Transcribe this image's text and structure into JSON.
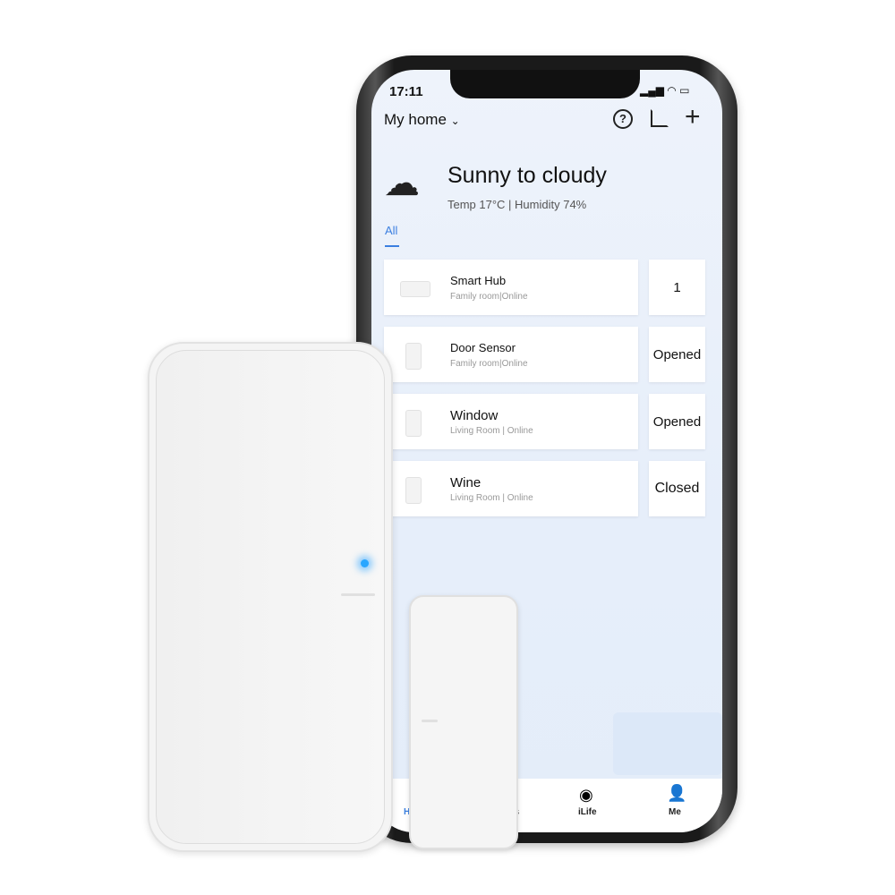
{
  "status_bar": {
    "time": "17:11"
  },
  "header": {
    "home_label": "My home",
    "help_icon": "help-circle-icon",
    "edit_icon": "edit-icon",
    "add_icon": "plus-icon"
  },
  "weather": {
    "icon": "partly-cloudy-icon",
    "title": "Sunny to cloudy",
    "details": "Temp 17°C | Humidity 74%"
  },
  "tabs": [
    {
      "label": "All",
      "active": true
    }
  ],
  "devices": [
    {
      "name": "Smart Hub",
      "location": "Family room|Online",
      "status": "1"
    },
    {
      "name": "Door Sensor",
      "location": "Family room|Online",
      "status": "Opened"
    },
    {
      "name": "Window",
      "location": "Living Room | Online",
      "status": "Opened"
    },
    {
      "name": "Wine",
      "location": "Living Room | Online",
      "status": "Closed"
    }
  ],
  "bottom_nav": [
    {
      "label": "H",
      "icon": "home-icon"
    },
    {
      "label": "s"
    },
    {
      "label": "iLife",
      "icon": "eye-icon"
    },
    {
      "label": "Me",
      "icon": "user-icon"
    }
  ],
  "colors": {
    "accent": "#3b7fe0",
    "led": "#29a6ff"
  }
}
